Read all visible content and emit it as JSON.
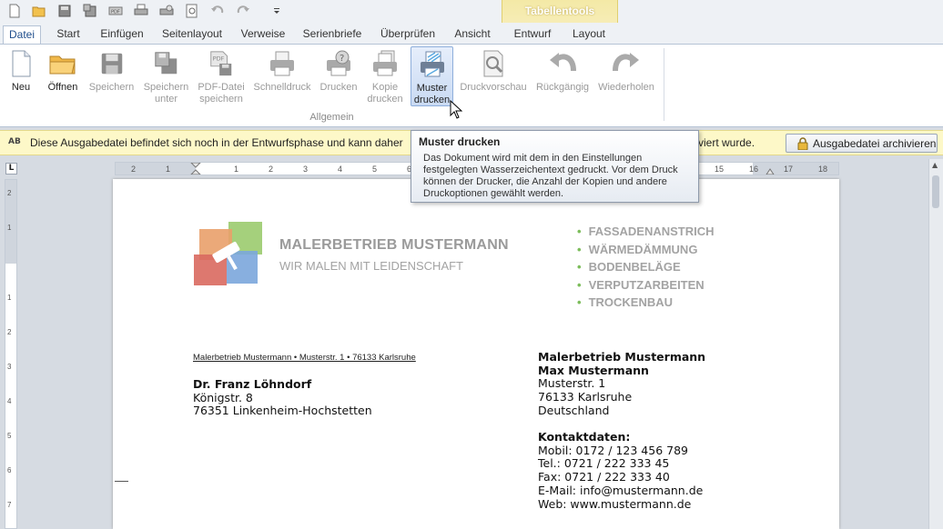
{
  "context_tab_group": "Tabellentools",
  "quick_access": [
    "new-icon",
    "open-icon",
    "save-icon",
    "save-as-icon",
    "pdf-icon",
    "print-icon",
    "quick-print-icon",
    "preview-icon",
    "undo-icon",
    "redo-icon",
    "customize-icon"
  ],
  "tabs": [
    {
      "label": "Datei",
      "active": true
    },
    {
      "label": "Start"
    },
    {
      "label": "Einfügen"
    },
    {
      "label": "Seitenlayout"
    },
    {
      "label": "Verweise"
    },
    {
      "label": "Serienbriefe"
    },
    {
      "label": "Überprüfen"
    },
    {
      "label": "Ansicht"
    },
    {
      "label": "Entwurf"
    },
    {
      "label": "Layout"
    }
  ],
  "ribbon": {
    "group_label": "Allgemein",
    "buttons": [
      {
        "label": "Neu",
        "icon": "new-document-icon",
        "enabled": true
      },
      {
        "label": "Öffnen",
        "icon": "folder-icon",
        "enabled": true
      },
      {
        "label": "Speichern",
        "icon": "floppy-icon",
        "enabled": false
      },
      {
        "label": "Speichern\nunter",
        "icon": "save-as-icon",
        "enabled": false
      },
      {
        "label": "PDF-Datei\nspeichern",
        "icon": "pdf-save-icon",
        "enabled": false
      },
      {
        "label": "Schnelldruck",
        "icon": "printer-icon",
        "enabled": false
      },
      {
        "label": "Drucken",
        "icon": "print-dialog-icon",
        "enabled": false
      },
      {
        "label": "Kopie\ndrucken",
        "icon": "copy-print-icon",
        "enabled": false
      },
      {
        "label": "Muster\ndrucken",
        "icon": "sample-print-icon",
        "enabled": true,
        "hover": true
      },
      {
        "label": "Druckvorschau",
        "icon": "print-preview-icon",
        "enabled": false
      },
      {
        "label": "Rückgängig",
        "icon": "undo-icon",
        "enabled": false
      },
      {
        "label": "Wiederholen",
        "icon": "redo-icon",
        "enabled": false
      }
    ]
  },
  "infobar": {
    "text": "Diese Ausgabedatei befindet sich noch in der Entwurfsphase und kann daher",
    "text_end": "viert wurde.",
    "button": "Ausgabedatei archivieren"
  },
  "tooltip": {
    "title": "Muster drucken",
    "body": "Das Dokument wird mit dem in den Einstellungen festgelegten Wasserzeichentext gedruckt. Vor dem Druck können der Drucker, die Anzahl der Kopien und andere Druckoptionen gewählt werden."
  },
  "ruler": {
    "h_ticks": [
      "2",
      "1",
      "1",
      "1",
      "2",
      "3",
      "4",
      "5",
      "6",
      "15",
      "16",
      "17",
      "18"
    ],
    "v_ticks": [
      "2",
      "1",
      "1",
      "2",
      "3",
      "4",
      "5",
      "6",
      "7"
    ]
  },
  "document": {
    "company_name": "MALERBETRIEB MUSTERMANN",
    "company_slogan": "WIR MALEN MIT LEIDENSCHAFT",
    "services": [
      "FASSADENANSTRICH",
      "WÄRMEDÄMMUNG",
      "BODENBELÄGE",
      "VERPUTZARBEITEN",
      "TROCKENBAU"
    ],
    "sender_line": "Malerbetrieb Mustermann • Musterstr. 1 • 76133 Karlsruhe",
    "recipient": {
      "name": "Dr. Franz Löhndorf",
      "street": "Königstr. 8",
      "city": "76351 Linkenheim-Hochstetten"
    },
    "sender": {
      "company": "Malerbetrieb Mustermann",
      "person": "Max Mustermann",
      "street": "Musterstr. 1",
      "city": "76133 Karlsruhe",
      "country": "Deutschland"
    },
    "contact": {
      "heading": "Kontaktdaten:",
      "mobile": "Mobil: 0172 / 123 456 789",
      "tel": "Tel.: 0721 / 222 333 45",
      "fax": "Fax: 0721 / 222 333 40",
      "email": "E-Mail: info@mustermann.de",
      "web": "Web: www.mustermann.de"
    }
  },
  "colors": {
    "accent": "#1f4e8c",
    "infobar_bg": "#fdf8c8",
    "bullet": "#7cbd5b",
    "logo_orange": "#e9a06a",
    "logo_green": "#9bcb6e",
    "logo_blue": "#7ba6dc",
    "logo_red": "#d9695f"
  }
}
